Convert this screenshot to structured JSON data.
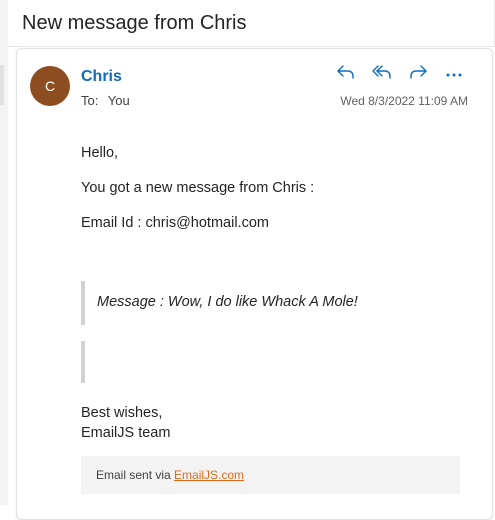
{
  "header": {
    "title": "New message from Chris"
  },
  "message": {
    "avatar_initial": "C",
    "avatar_color": "#8c4e20",
    "sender_name": "Chris",
    "to_label": "To:",
    "to_value": "You",
    "timestamp": "Wed 8/3/2022 11:09 AM",
    "actions": [
      {
        "name": "reply-icon"
      },
      {
        "name": "reply-all-icon"
      },
      {
        "name": "forward-icon"
      },
      {
        "name": "more-icon"
      }
    ]
  },
  "body": {
    "greeting": "Hello,",
    "line1": "You got a new message from Chris :",
    "email_line": "Email Id : chris@hotmail.com",
    "quote": "Message : Wow, I do like Whack A Mole!",
    "signoff1": "Best wishes,",
    "signoff2": "EmailJS team"
  },
  "footer": {
    "prefix": "Email sent via ",
    "link_text": "EmailJS.com"
  },
  "colors": {
    "accent": "#0f6cbd",
    "link": "#e36a1a"
  }
}
